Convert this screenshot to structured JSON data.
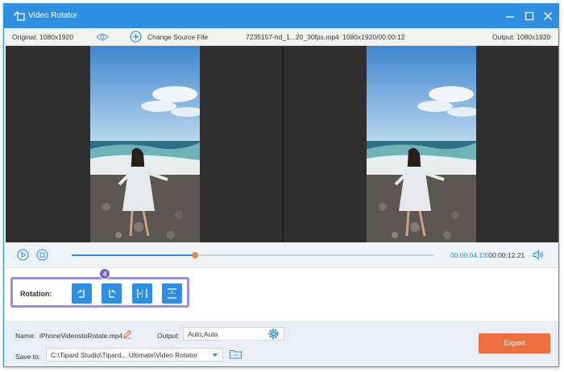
{
  "window": {
    "title": "Video Rotator"
  },
  "infobar": {
    "original": "Original: 1080x1920",
    "change_source": "Change Source File",
    "filename": "7235157-hd_1...20_30fps.mp4",
    "meta": "1080x1920/00:00:12",
    "output": "Output: 1080x1920"
  },
  "playback": {
    "current_time": "00:00:04.13",
    "separator": "/",
    "total_time": "00:00:12.21",
    "progress": 0.34
  },
  "rotation": {
    "step": "4",
    "label": "Rotation:",
    "buttons": [
      "rotate-left",
      "rotate-right",
      "flip-horizontal",
      "flip-vertical"
    ]
  },
  "bottom": {
    "name_label": "Name:",
    "name_value": "iPhoneVideostoRotate.mp4",
    "output_label": "Output:",
    "output_value": "Auto;Auto",
    "saveto_label": "Save to:",
    "saveto_value": "C:\\Tipard Studio\\Tipard... Ultimate\\Video Rotator",
    "export_label": "Export"
  },
  "colors": {
    "accent": "#2e8fe0",
    "export": "#ee6f3f",
    "highlight": "#9b8fe0",
    "badge": "#7b5bd4",
    "thumb": "#f08a3a"
  }
}
